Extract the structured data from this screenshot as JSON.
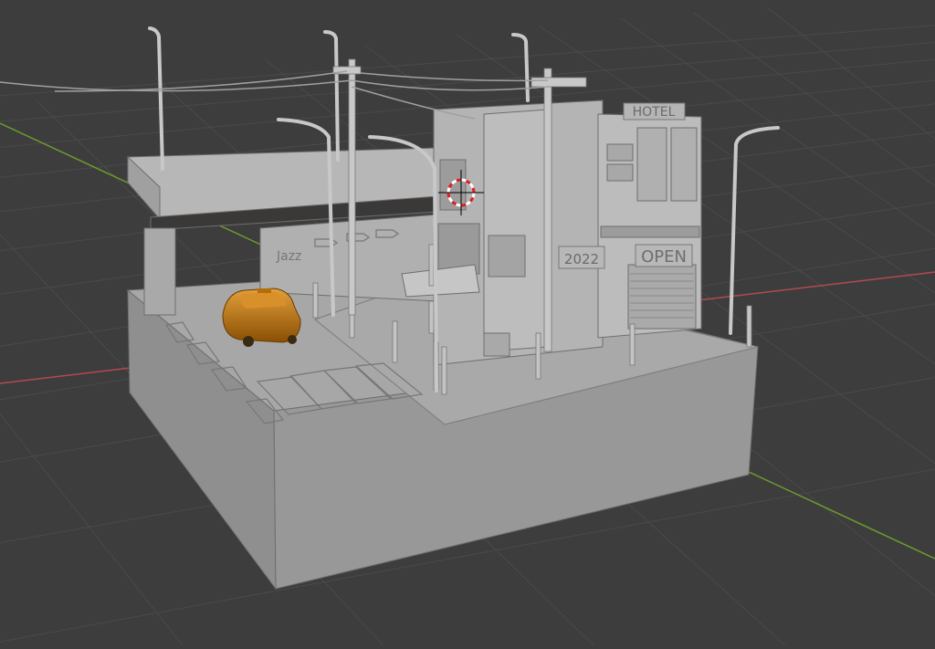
{
  "viewport": {
    "background": "#3d3d3d",
    "grid_color": "#4a4a4a",
    "x_axis_color": "#b34a4f",
    "y_axis_color": "#6a9a2e"
  },
  "scene": {
    "signs": {
      "hotel": "HOTEL",
      "open": "OPEN",
      "year": "2022",
      "jazz": "Jazz"
    },
    "car_color": "#c77a10",
    "model_color": "#a3a3a3",
    "cursor_icon": "3d-cursor-icon"
  }
}
